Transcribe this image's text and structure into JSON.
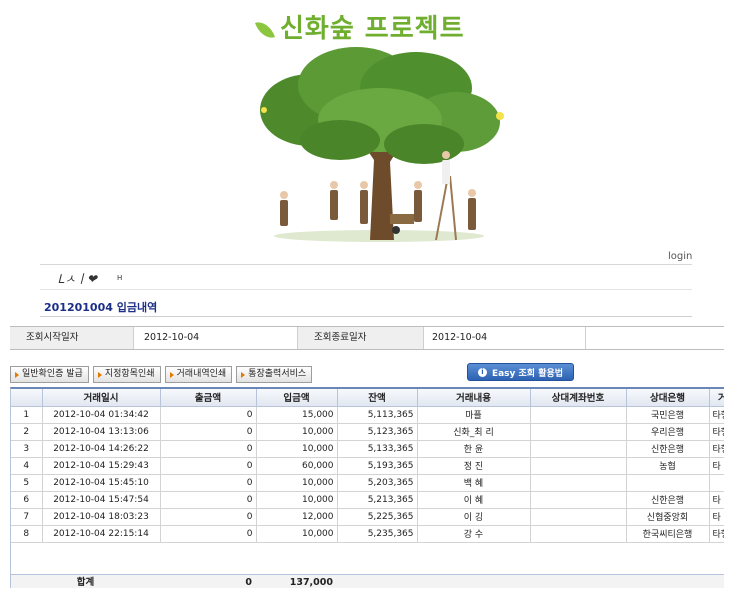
{
  "header": {
    "title": "신화숲 프로젝트"
  },
  "nav": {
    "login_label": "login",
    "signature_text": "Ꮮㅅㅣ❤",
    "signature_h": "H"
  },
  "page": {
    "title": "201201004 입금내역"
  },
  "date_filter": {
    "start_label": "조회시작일자",
    "start_value": "2012-10-04",
    "end_label": "조회종료일자",
    "end_value": "2012-10-04"
  },
  "toolbar": {
    "buttons": [
      "일반확인증 발급",
      "지정항목인쇄",
      "거래내역인쇄",
      "통장출력서비스"
    ],
    "easy_label": "Easy 조회 활용법",
    "easy_icon": "info-icon"
  },
  "table": {
    "columns": [
      "",
      "거래일시",
      "출금액",
      "입금액",
      "잔액",
      "거래내용",
      "상대계좌번호",
      "상대은행",
      "거래구"
    ],
    "rows": [
      [
        "1",
        "2012-10-04 01:34:42",
        "0",
        "15,000",
        "5,113,365",
        "마플",
        "",
        "국민은행",
        "타행이"
      ],
      [
        "2",
        "2012-10-04 13:13:06",
        "0",
        "10,000",
        "5,123,365",
        "신화_최 리",
        "",
        "우리은행",
        "타행이"
      ],
      [
        "3",
        "2012-10-04 14:26:22",
        "0",
        "10,000",
        "5,133,365",
        "한 윤",
        "",
        "신한은행",
        "타행이"
      ],
      [
        "4",
        "2012-10-04 15:29:43",
        "0",
        "60,000",
        "5,193,365",
        "정 진",
        "",
        "농협",
        "타 이"
      ],
      [
        "5",
        "2012-10-04 15:45:10",
        "0",
        "10,000",
        "5,203,365",
        "백 혜",
        "",
        "",
        ""
      ],
      [
        "6",
        "2012-10-04 15:47:54",
        "0",
        "10,000",
        "5,213,365",
        "이 혜",
        "",
        "신한은행",
        "타 이"
      ],
      [
        "7",
        "2012-10-04 18:03:23",
        "0",
        "12,000",
        "5,225,365",
        "이 깅",
        "",
        "신협중앙회",
        "타 이"
      ],
      [
        "8",
        "2012-10-04 22:15:14",
        "0",
        "10,000",
        "5,235,365",
        "강 수",
        "",
        "한국씨티은행",
        "타행이"
      ]
    ],
    "total_label": "합계",
    "total_withdraw": "0",
    "total_deposit": "137,000"
  }
}
